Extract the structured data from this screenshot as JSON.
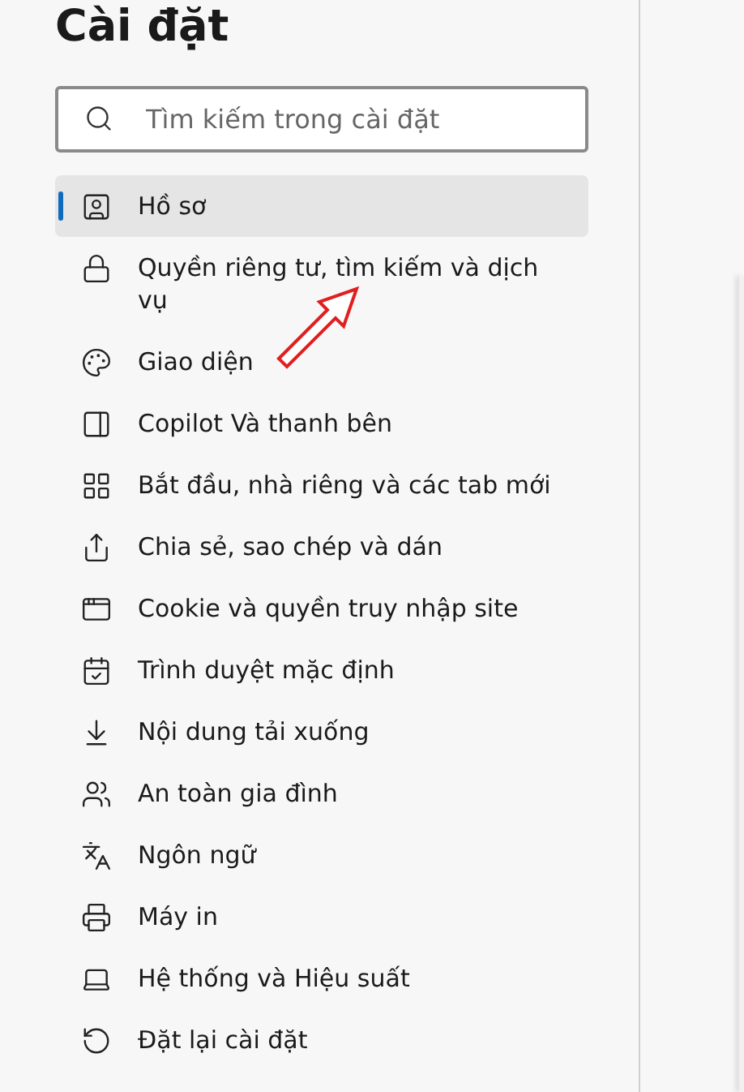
{
  "title": "Cài đặt",
  "search": {
    "placeholder": "Tìm kiếm trong cài đặt"
  },
  "menu": [
    {
      "label": "Hồ sơ",
      "selected": true
    },
    {
      "label": "Quyền riêng tư, tìm kiếm và dịch vụ",
      "selected": false
    },
    {
      "label": "Giao diện",
      "selected": false
    },
    {
      "label": "Copilot Và thanh bên",
      "selected": false
    },
    {
      "label": "Bắt đầu, nhà riêng và các tab mới",
      "selected": false
    },
    {
      "label": "Chia sẻ, sao chép và dán",
      "selected": false
    },
    {
      "label": "Cookie và quyền truy nhập site",
      "selected": false
    },
    {
      "label": "Trình duyệt mặc định",
      "selected": false
    },
    {
      "label": "Nội dung tải xuống",
      "selected": false
    },
    {
      "label": "An toàn gia đình",
      "selected": false
    },
    {
      "label": "Ngôn ngữ",
      "selected": false
    },
    {
      "label": "Máy in",
      "selected": false
    },
    {
      "label": "Hệ thống và Hiệu suất",
      "selected": false
    },
    {
      "label": "Đặt lại cài đặt",
      "selected": false
    }
  ]
}
